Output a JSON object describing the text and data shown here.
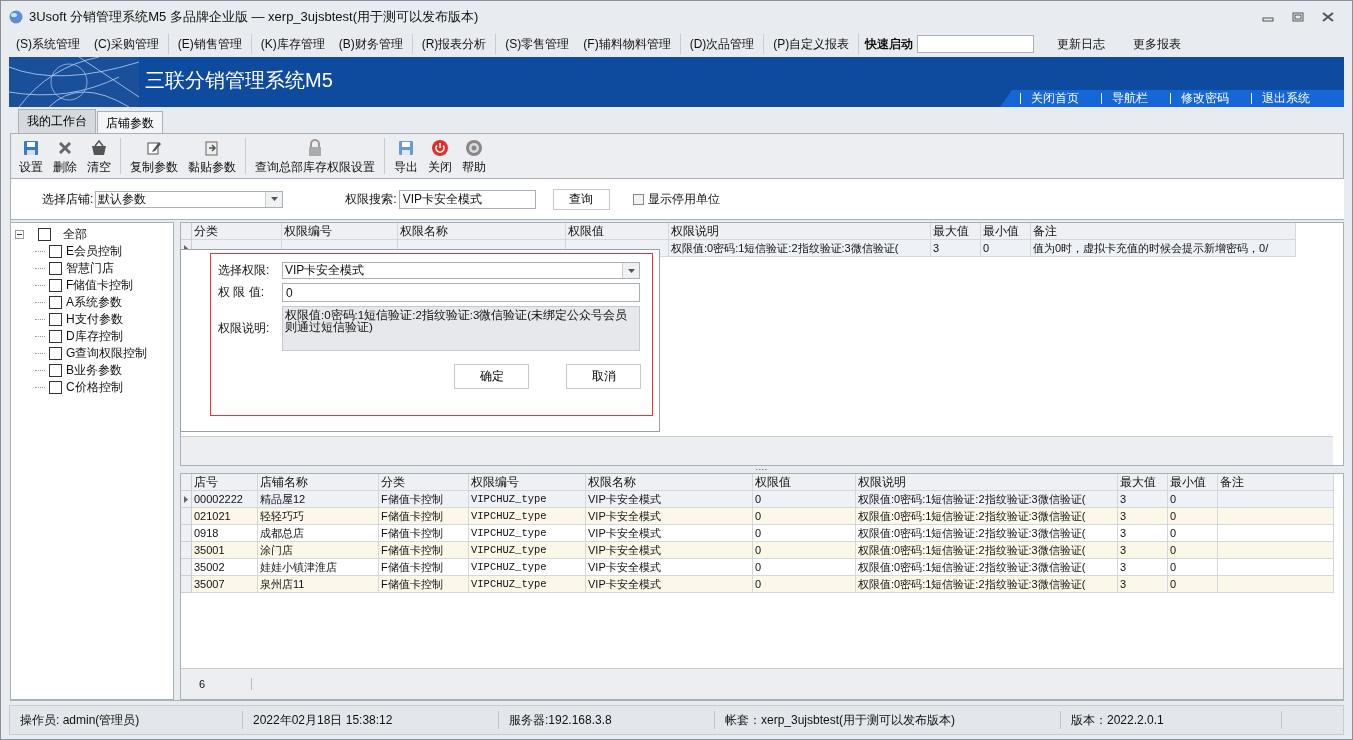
{
  "window": {
    "title": "3Usoft 分销管理系统M5 多品牌企业版 — xerp_3ujsbtest(用于测可以发布版本)"
  },
  "menu_groups": [
    [
      "(S)系统管理",
      "(C)采购管理"
    ],
    [
      "(E)销售管理"
    ],
    [
      "(K)库存管理",
      "(B)财务管理"
    ],
    [
      "(R)报表分析"
    ],
    [
      "(S)零售管理",
      "(F)辅料物料管理"
    ],
    [
      "(D)次品管理"
    ],
    [
      "(P)自定义报表"
    ]
  ],
  "quick_launch": {
    "label": "快速启动"
  },
  "menu_links": [
    "更新日志",
    "更多报表"
  ],
  "banner": {
    "title": "三联分销管理系统M5",
    "links": [
      "关闭首页",
      "导航栏",
      "修改密码",
      "退出系统"
    ]
  },
  "tabs": [
    {
      "label": "我的工作台",
      "selected": false
    },
    {
      "label": "店铺参数",
      "selected": true
    }
  ],
  "toolbar_groups": [
    [
      {
        "label": "设置",
        "kind": "save"
      },
      {
        "label": "删除",
        "kind": "delete"
      },
      {
        "label": "清空",
        "kind": "clear"
      }
    ],
    [
      {
        "label": "复制参数",
        "kind": "edit"
      },
      {
        "label": "黏贴参数",
        "kind": "paste"
      }
    ],
    [
      {
        "label": "查询总部库存权限设置",
        "kind": "lock"
      }
    ],
    [
      {
        "label": "导出",
        "kind": "export"
      },
      {
        "label": "关闭",
        "kind": "close"
      },
      {
        "label": "帮助",
        "kind": "help"
      }
    ]
  ],
  "filter": {
    "store_label": "选择店铺:",
    "store_value": "默认参数",
    "search_label": "权限搜索:",
    "search_value": "VIP卡安全模式",
    "query_button": "查询",
    "show_disabled": {
      "label": "显示停用单位",
      "checked": false
    }
  },
  "tree": {
    "label": "全部",
    "checked": false,
    "expanded": true,
    "children": [
      {
        "label": "E会员控制",
        "checked": false
      },
      {
        "label": "智慧门店",
        "checked": false
      },
      {
        "label": "F储值卡控制",
        "checked": false
      },
      {
        "label": "A系统参数",
        "checked": false
      },
      {
        "label": "H支付参数",
        "checked": false
      },
      {
        "label": "D库存控制",
        "checked": false
      },
      {
        "label": "G查询权限控制",
        "checked": false
      },
      {
        "label": "B业务参数",
        "checked": false
      },
      {
        "label": "C价格控制",
        "checked": false
      }
    ]
  },
  "top_grid": {
    "columns": [
      "分类",
      "权限编号",
      "权限名称",
      "权限值",
      "权限说明",
      "最大值",
      "最小值",
      "备注"
    ],
    "rows": [
      {
        "selected": true,
        "description": "权限值:0密码:1短信验证:2指纹验证:3微信验证(",
        "max": "3",
        "min": "0",
        "note": "值为0时，虚拟卡充值的时候会提示新增密码，0/"
      }
    ]
  },
  "dialog": {
    "permission_label": "选择权限:",
    "permission_value": "VIP卡安全模式",
    "value_label": "权 限 值:",
    "value": "0",
    "description_label": "权限说明:",
    "description": "权限值:0密码:1短信验证:2指纹验证:3微信验证(未绑定公众号会员则通过短信验证)",
    "ok": "确定",
    "cancel": "取消"
  },
  "bottom_grid": {
    "columns": [
      "店号",
      "店铺名称",
      "分类",
      "权限编号",
      "权限名称",
      "权限值",
      "权限说明",
      "最大值",
      "最小值",
      "备注"
    ],
    "rows": [
      {
        "selected": true,
        "cells": [
          "00002222",
          "精品屋12",
          "F储值卡控制",
          "VIPCHUZ_type",
          "VIP卡安全模式",
          "0",
          "权限值:0密码:1短信验证:2指纹验证:3微信验证(",
          "3",
          "0"
        ]
      },
      {
        "selected": false,
        "cells": [
          "021021",
          "轻轻巧巧",
          "F储值卡控制",
          "VIPCHUZ_type",
          "VIP卡安全模式",
          "0",
          "权限值:0密码:1短信验证:2指纹验证:3微信验证(",
          "3",
          "0"
        ]
      },
      {
        "selected": false,
        "cells": [
          "0918",
          "成都总店",
          "F储值卡控制",
          "VIPCHUZ_type",
          "VIP卡安全模式",
          "0",
          "权限值:0密码:1短信验证:2指纹验证:3微信验证(",
          "3",
          "0"
        ]
      },
      {
        "selected": false,
        "cells": [
          "35001",
          "涂门店",
          "F储值卡控制",
          "VIPCHUZ_type",
          "VIP卡安全模式",
          "0",
          "权限值:0密码:1短信验证:2指纹验证:3微信验证(",
          "3",
          "0"
        ]
      },
      {
        "selected": false,
        "cells": [
          "35002",
          "娃娃小镇津淮店",
          "F储值卡控制",
          "VIPCHUZ_type",
          "VIP卡安全模式",
          "0",
          "权限值:0密码:1短信验证:2指纹验证:3微信验证(",
          "3",
          "0"
        ]
      },
      {
        "selected": false,
        "cells": [
          "35007",
          "泉州店11",
          "F储值卡控制",
          "VIPCHUZ_type",
          "VIP卡安全模式",
          "0",
          "权限值:0密码:1短信验证:2指纹验证:3微信验证(",
          "3",
          "0"
        ]
      }
    ],
    "count": "6"
  },
  "status_bar": [
    "操作员: admin(管理员)",
    "2022年02月18日 15:38:12",
    "服务器:192.168.3.8",
    "帐套：xerp_3ujsbtest(用于测可以发布版本)",
    "版本：2022.2.0.1"
  ]
}
